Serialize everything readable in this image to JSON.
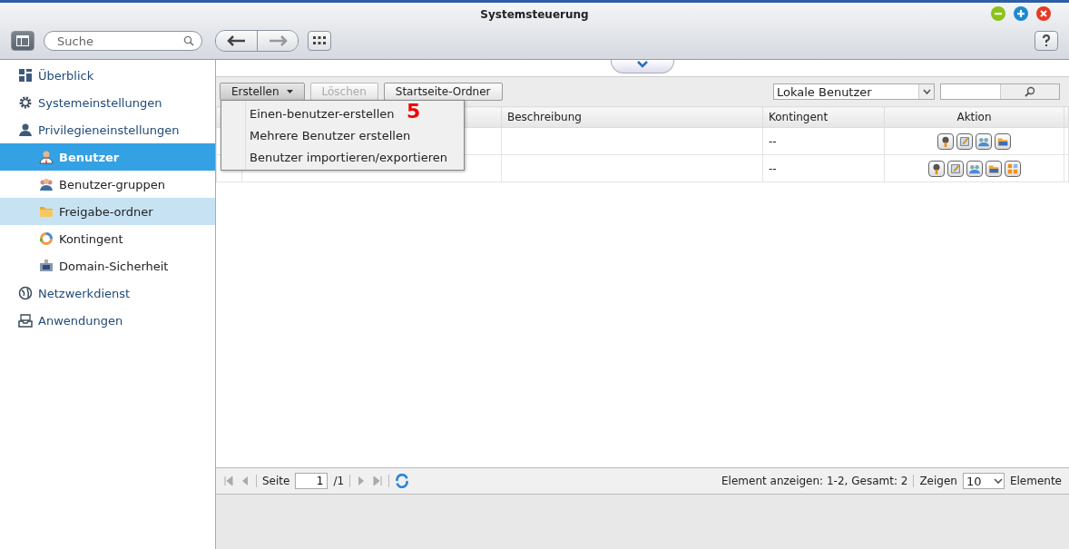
{
  "window": {
    "title": "Systemsteuerung"
  },
  "toolbar": {
    "search": {
      "placeholder": "Suche"
    }
  },
  "sidebar": {
    "items": [
      {
        "label": "Überblick",
        "selected": false,
        "highlighted": false
      },
      {
        "label": "Systemeinstellungen",
        "selected": false,
        "highlighted": false
      },
      {
        "label": "Privilegieneinstellungen",
        "selected": false,
        "highlighted": false,
        "children": [
          {
            "label": "Benutzer",
            "selected": true,
            "highlighted": false
          },
          {
            "label": "Benutzer-gruppen",
            "selected": false,
            "highlighted": false
          },
          {
            "label": "Freigabe-ordner",
            "selected": false,
            "highlighted": true
          },
          {
            "label": "Kontingent",
            "selected": false,
            "highlighted": false
          },
          {
            "label": "Domain-Sicherheit",
            "selected": false,
            "highlighted": false
          }
        ]
      },
      {
        "label": "Netzwerkdienst",
        "selected": false,
        "highlighted": false
      },
      {
        "label": "Anwendungen",
        "selected": false,
        "highlighted": false
      }
    ]
  },
  "actions": {
    "buttons": [
      {
        "label": "Erstellen",
        "kind": "dropdown",
        "disabled": false
      },
      {
        "label": "Löschen",
        "kind": "plain",
        "disabled": true
      },
      {
        "label": "Startseite-Ordner",
        "kind": "plain",
        "disabled": false
      }
    ],
    "filter": {
      "value": "Lokale Benutzer"
    }
  },
  "menu": {
    "items": [
      "Einen-benutzer-erstellen",
      "Mehrere Benutzer erstellen",
      "Benutzer importieren/exportieren"
    ],
    "annotation": "5"
  },
  "table": {
    "columns": [
      "Beschreibung",
      "Kontingent",
      "Aktion"
    ],
    "rows": [
      {
        "quota": "--",
        "actions": [
          {
            "kind": "key"
          },
          {
            "kind": "edit"
          },
          {
            "kind": "group"
          },
          {
            "kind": "folder"
          }
        ]
      },
      {
        "quota": "--",
        "actions": [
          {
            "kind": "key"
          },
          {
            "kind": "edit"
          },
          {
            "kind": "group"
          },
          {
            "kind": "folder"
          },
          {
            "kind": "apps"
          }
        ]
      }
    ]
  },
  "pager": {
    "page_label": "Seite",
    "page": "1",
    "total_pages": "/1",
    "summary": "Element anzeigen: 1-2, Gesamt: 2",
    "show_label": "Zeigen",
    "page_size": "10",
    "unit": "Elemente"
  }
}
